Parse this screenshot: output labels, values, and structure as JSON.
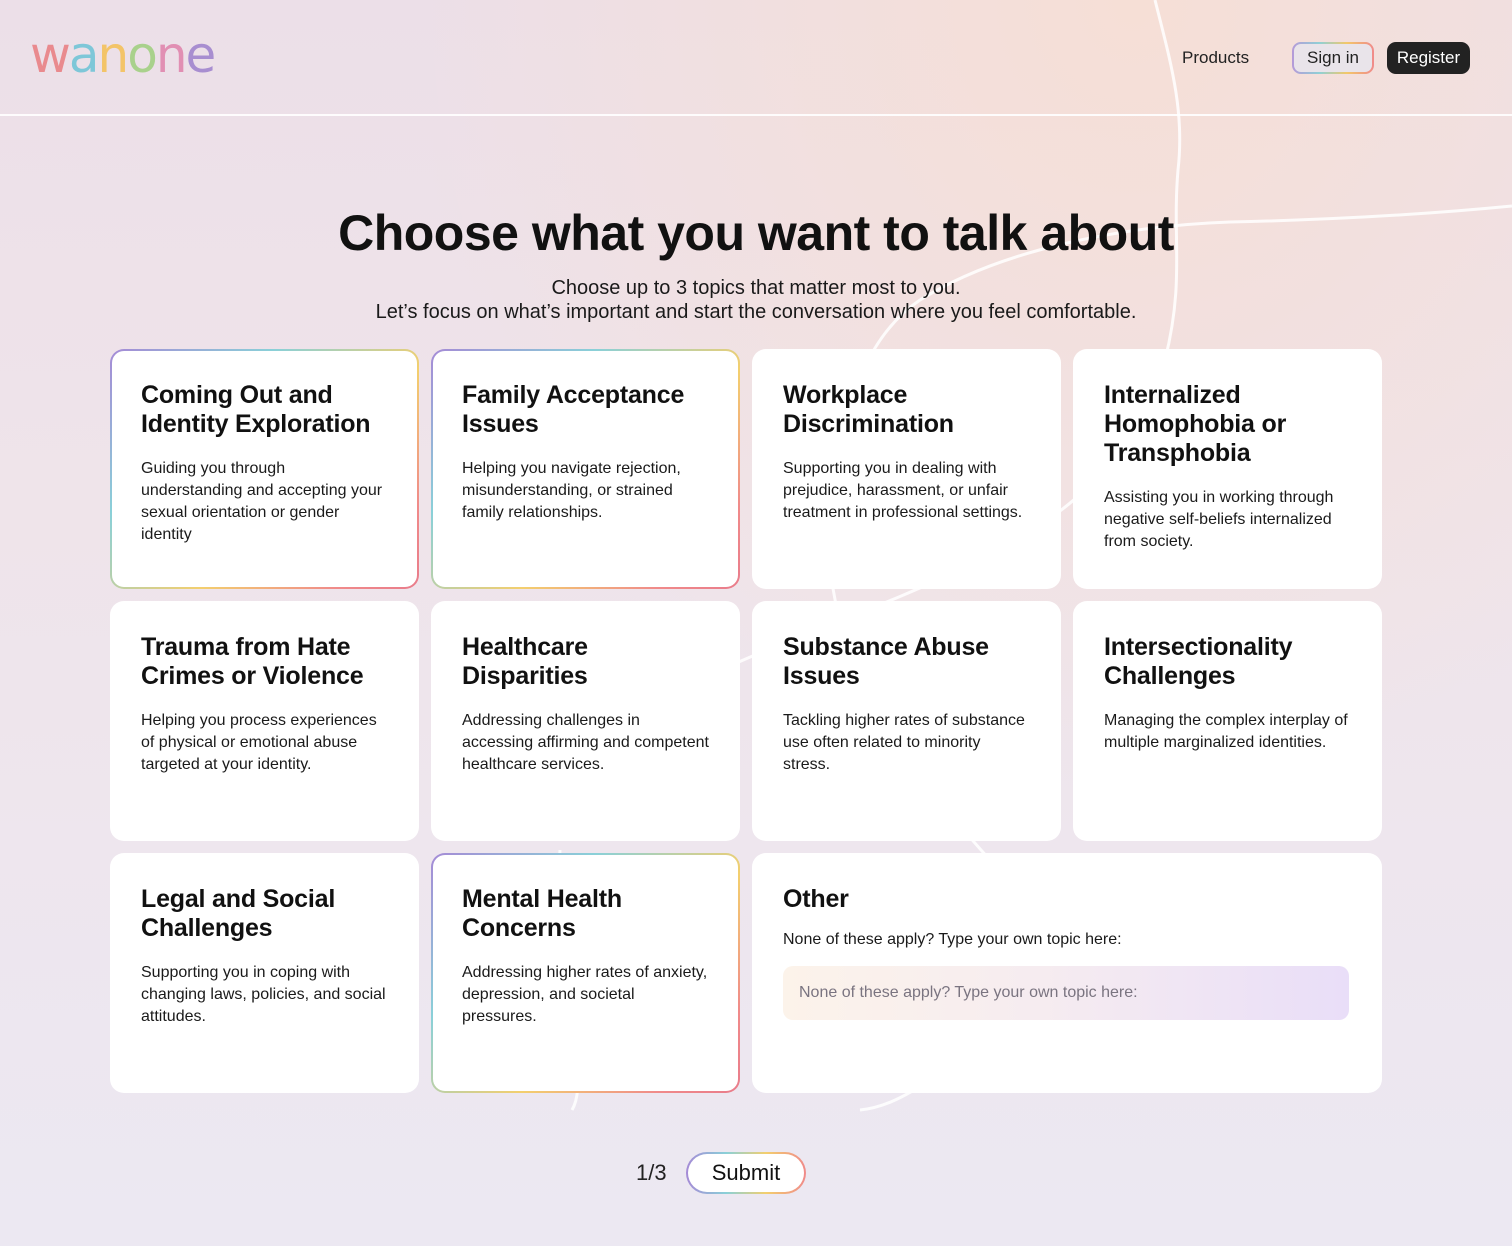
{
  "header": {
    "logo_letters": [
      {
        "char": "w",
        "color": "#e98a8e"
      },
      {
        "char": "a",
        "color": "#7ec7d8"
      },
      {
        "char": "n",
        "color": "#f3c468"
      },
      {
        "char": "o",
        "color": "#a9d18c"
      },
      {
        "char": "n",
        "color": "#e18fb3"
      },
      {
        "char": "e",
        "color": "#a88ed0"
      }
    ],
    "products_label": "Products",
    "signin_label": "Sign in",
    "register_label": "Register"
  },
  "main": {
    "title": "Choose what you want to talk about",
    "subtitle_line1": "Choose up to 3 topics that matter most to you.",
    "subtitle_line2": "Let’s focus on what’s important and start the conversation where you feel comfortable."
  },
  "topics": [
    {
      "title": "Coming Out and Identity Exploration",
      "desc": "Guiding you through understanding and accepting your sexual orientation or gender identity",
      "selected": true
    },
    {
      "title": "Family Acceptance Issues",
      "desc": "Helping you navigate rejection, misunderstanding, or strained family relationships.",
      "selected": true
    },
    {
      "title": "Workplace Discrimination",
      "desc": "Supporting you in dealing with prejudice, harassment, or unfair treatment in professional settings.",
      "selected": false
    },
    {
      "title": "Internalized Homophobia or Transphobia",
      "desc": "Assisting you in working through negative self-beliefs internalized from society.",
      "selected": false
    },
    {
      "title": "Trauma from Hate Crimes or Violence",
      "desc": "Helping you process experiences of physical or emotional abuse targeted at your identity.",
      "selected": false
    },
    {
      "title": "Healthcare Disparities",
      "desc": "Addressing challenges in accessing affirming and competent healthcare services.",
      "selected": false
    },
    {
      "title": "Substance Abuse Issues",
      "desc": "Tackling higher rates of substance use often related to minority stress.",
      "selected": false
    },
    {
      "title": "Intersectionality Challenges",
      "desc": "Managing the complex interplay of multiple marginalized identities.",
      "selected": false
    },
    {
      "title": "Legal and Social Challenges",
      "desc": "Supporting you in coping with changing laws, policies, and social attitudes.",
      "selected": false
    },
    {
      "title": "Mental Health Concerns",
      "desc": "Addressing higher rates of anxiety, depression, and societal pressures.",
      "selected": true
    }
  ],
  "other": {
    "title": "Other",
    "prompt": "None of these apply? Type your own topic here:",
    "placeholder": "None of these apply? Type your own topic here:",
    "value": ""
  },
  "footer": {
    "counter": "1/3",
    "submit_label": "Submit"
  }
}
